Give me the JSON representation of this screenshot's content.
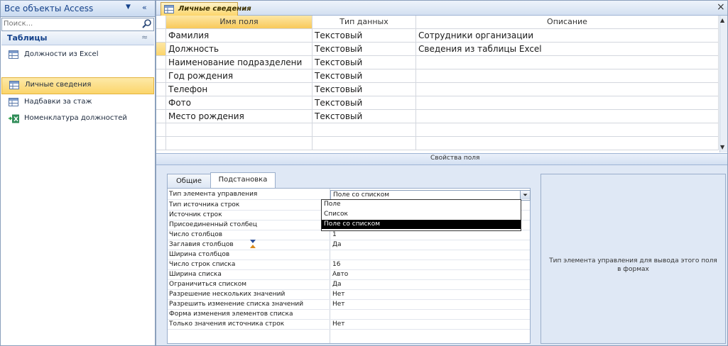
{
  "nav": {
    "title": "Все объекты Access",
    "dropdown_icon": "chevron-down-icon",
    "collapse_icon": "double-chevron-left-icon",
    "search_placeholder": "Поиск...",
    "group_label": "Таблицы",
    "items": [
      {
        "label": "Должности из Excel",
        "icon": "table-icon",
        "selected": false
      },
      {
        "label": "Личные сведения",
        "icon": "table-icon",
        "selected": true
      },
      {
        "label": "Надбавки за стаж",
        "icon": "table-icon",
        "selected": false
      },
      {
        "label": "Номенклатура должностей",
        "icon": "linked-excel-table-icon",
        "selected": false
      }
    ]
  },
  "document": {
    "tab_label": "Личные сведения",
    "close_glyph": "×"
  },
  "grid": {
    "headers": [
      "Имя поля",
      "Тип данных",
      "Описание"
    ],
    "rows": [
      {
        "name": "Фамилия",
        "type": "Текстовый",
        "desc": "Сотрудники организации"
      },
      {
        "name": "Должность",
        "type": "Текстовый",
        "desc": "Сведения из таблицы Excel"
      },
      {
        "name": "Наименование подразделени",
        "type": "Текстовый",
        "desc": ""
      },
      {
        "name": "Год рождения",
        "type": "Текстовый",
        "desc": ""
      },
      {
        "name": "Телефон",
        "type": "Текстовый",
        "desc": ""
      },
      {
        "name": "Фото",
        "type": "Текстовый",
        "desc": ""
      },
      {
        "name": "Место рождения",
        "type": "Текстовый",
        "desc": ""
      },
      {
        "name": "",
        "type": "",
        "desc": ""
      },
      {
        "name": "",
        "type": "",
        "desc": ""
      }
    ],
    "current_row": 1
  },
  "properties": {
    "band_label": "Свойства поля",
    "tabs": [
      "Общие",
      "Подстановка"
    ],
    "active_tab": "Подстановка",
    "rows": [
      {
        "label": "Тип элемента управления",
        "value": "Поле со списком"
      },
      {
        "label": "Тип источника строк",
        "value": ""
      },
      {
        "label": "Источник строк",
        "value": ""
      },
      {
        "label": "Присоединенный столбец",
        "value": ""
      },
      {
        "label": "Число столбцов",
        "value": "1"
      },
      {
        "label": "Заглавия столбцов",
        "value": "Да"
      },
      {
        "label": "Ширина столбцов",
        "value": ""
      },
      {
        "label": "Число строк списка",
        "value": "16"
      },
      {
        "label": "Ширина списка",
        "value": "Авто"
      },
      {
        "label": "Ограничиться списком",
        "value": "Да"
      },
      {
        "label": "Разрешение нескольких значений",
        "value": "Нет"
      },
      {
        "label": "Разрешить изменение списка значений",
        "value": "Нет"
      },
      {
        "label": "Форма изменения элементов списка",
        "value": ""
      },
      {
        "label": "Только значения источника строк",
        "value": "Нет"
      }
    ],
    "combo_value": "Поле со списком",
    "dropdown_options": [
      "Поле",
      "Список",
      "Поле со списком"
    ],
    "dropdown_selected": "Поле со списком",
    "help_text": "Тип элемента управления для вывода этого поля в формах"
  }
}
